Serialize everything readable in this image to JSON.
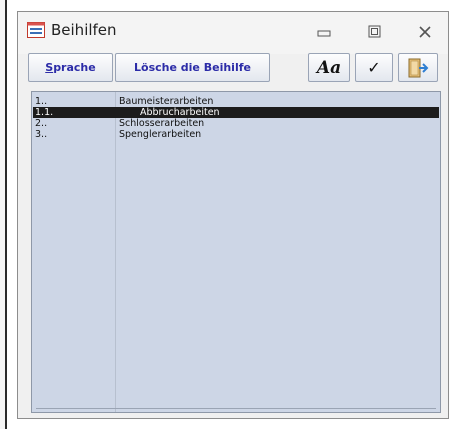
{
  "window": {
    "title": "Beihilfen"
  },
  "toolbar": {
    "sprache_first": "S",
    "sprache_rest": "prache",
    "delete_label": "Lösche die Beihilfe",
    "font_label": "Aa",
    "ok_glyph": "✓"
  },
  "list": {
    "rows": [
      {
        "num": "1..",
        "text": "Baumeisterarbeiten",
        "selected": false
      },
      {
        "num": "1.1.",
        "text": "Abbrucharbeiten",
        "selected": true
      },
      {
        "num": "2..",
        "text": "Schlosserarbeiten",
        "selected": false
      },
      {
        "num": "3..",
        "text": "Spenglerarbeiten",
        "selected": false
      }
    ]
  },
  "colors": {
    "accent_text": "#2c2ca8",
    "list_bg": "#cdd6e6",
    "selection_bg": "#1c1c1c"
  },
  "icons": [
    "form-icon",
    "minimize-icon",
    "maximize-icon",
    "close-icon",
    "check-icon",
    "exit-door-icon"
  ]
}
